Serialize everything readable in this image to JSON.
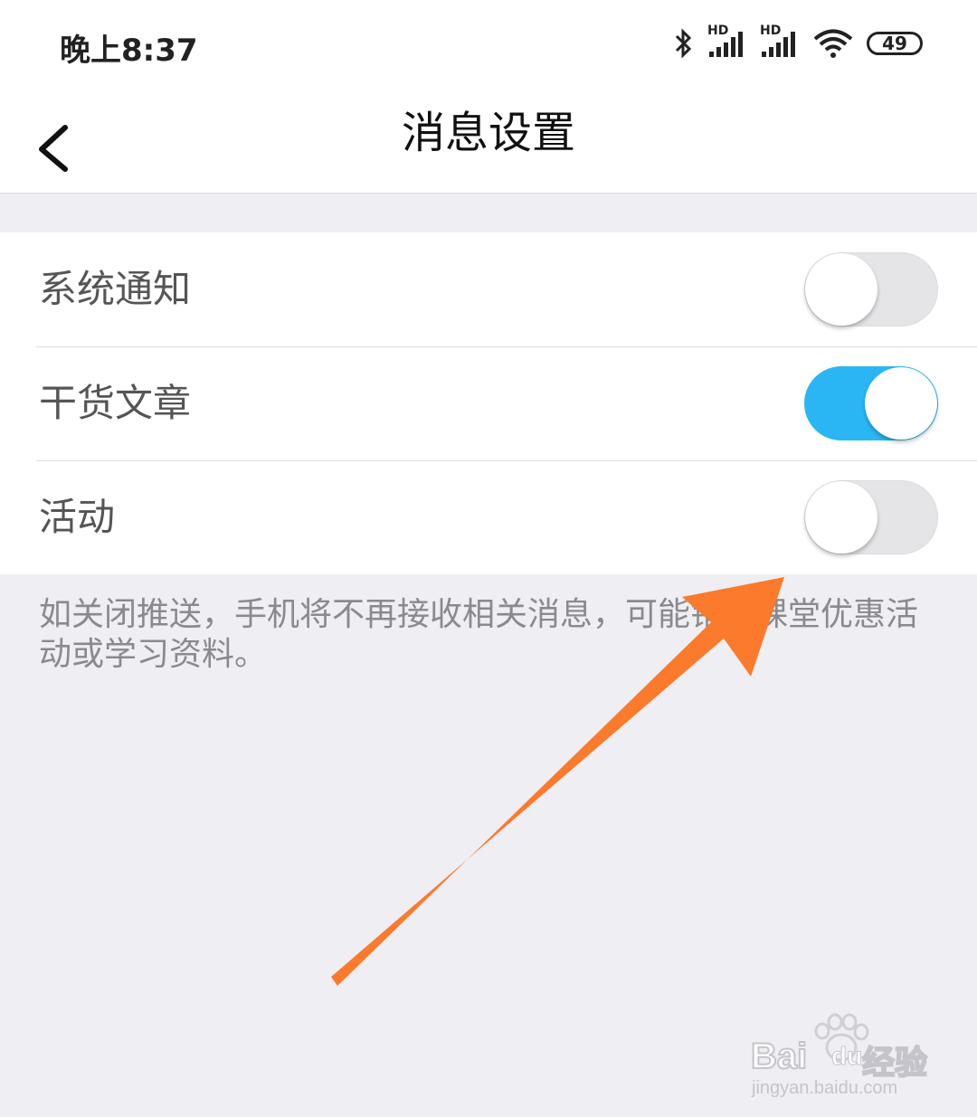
{
  "status_bar": {
    "time": "晚上8:37",
    "signal1_tag": "HD",
    "signal2_tag": "HD",
    "battery": "49"
  },
  "nav": {
    "title": "消息设置"
  },
  "settings": [
    {
      "label": "系统通知",
      "enabled": false
    },
    {
      "label": "干货文章",
      "enabled": true
    },
    {
      "label": "活动",
      "enabled": false
    }
  ],
  "hint": "如关闭推送，手机将不再接收相关消息，可能错过课堂优惠活动或学习资料。",
  "watermark": {
    "brand_left": "Bai",
    "brand_right": "du",
    "brand_cn": "经验",
    "url": "jingyan.baidu.com"
  },
  "colors": {
    "toggle_on": "#2ab6f5",
    "toggle_off": "#e5e5e8",
    "arrow": "#fb7a2c",
    "background": "#efeef3"
  }
}
